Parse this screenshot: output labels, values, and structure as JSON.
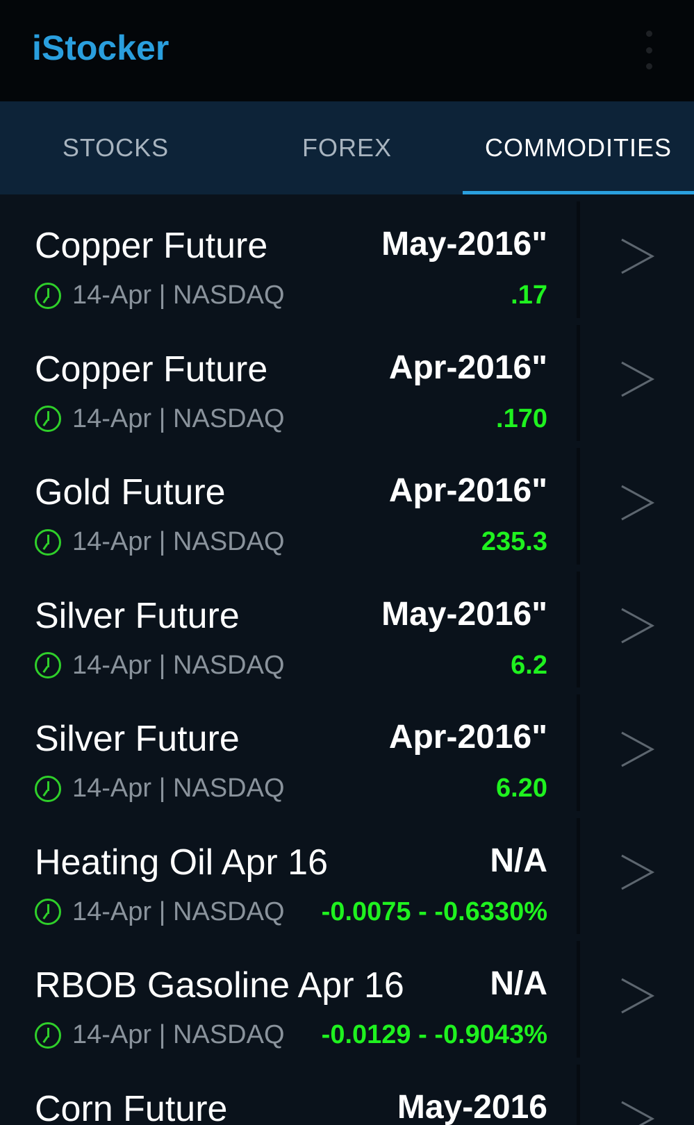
{
  "app": {
    "title": "iStocker"
  },
  "tabs": [
    {
      "label": "STOCKS",
      "active": false
    },
    {
      "label": "FOREX",
      "active": false
    },
    {
      "label": "COMMODITIES",
      "active": true
    }
  ],
  "items": [
    {
      "name": "Copper Future",
      "price": "May-2016\"",
      "meta": "14-Apr | NASDAQ",
      "change": ".17"
    },
    {
      "name": "Copper Future",
      "price": "Apr-2016\"",
      "meta": "14-Apr | NASDAQ",
      "change": ".170"
    },
    {
      "name": "Gold Future",
      "price": "Apr-2016\"",
      "meta": "14-Apr | NASDAQ",
      "change": "235.3"
    },
    {
      "name": "Silver Future",
      "price": "May-2016\"",
      "meta": "14-Apr | NASDAQ",
      "change": "6.2"
    },
    {
      "name": "Silver Future",
      "price": "Apr-2016\"",
      "meta": "14-Apr | NASDAQ",
      "change": "6.20"
    },
    {
      "name": "Heating Oil Apr 16",
      "price": "N/A",
      "meta": "14-Apr | NASDAQ",
      "change": "-0.0075 - -0.6330%"
    },
    {
      "name": "RBOB Gasoline Apr 16",
      "price": "N/A",
      "meta": "14-Apr | NASDAQ",
      "change": "-0.0129 - -0.9043%"
    },
    {
      "name": "Corn Future",
      "price": "May-2016",
      "meta": "",
      "change": ""
    }
  ],
  "colors": {
    "accent": "#2a9fde",
    "positive": "#1ff21f",
    "clock": "#2fcf2a"
  }
}
